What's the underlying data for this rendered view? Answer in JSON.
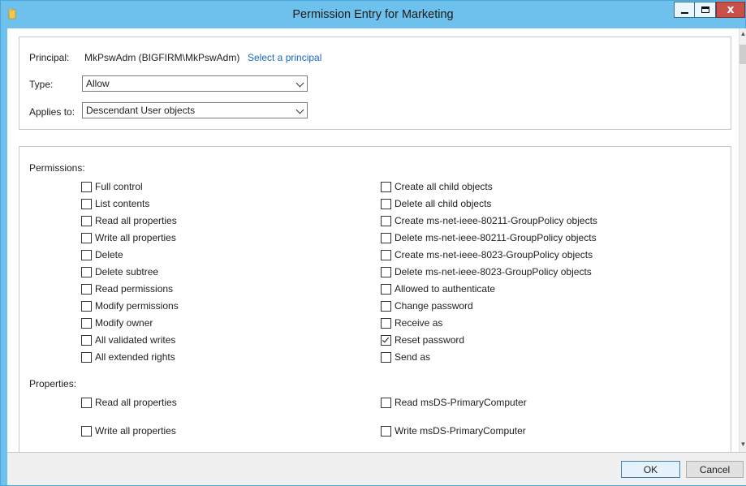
{
  "window": {
    "title": "Permission Entry for Marketing",
    "close_glyph": "x"
  },
  "header": {
    "principal_label": "Principal:",
    "principal_value": "MkPswAdm (BIGFIRM\\MkPswAdm)",
    "select_principal_link": "Select a principal",
    "type_label": "Type:",
    "type_value": "Allow",
    "applies_to_label": "Applies to:",
    "applies_to_value": "Descendant User objects"
  },
  "permissions": {
    "label": "Permissions:",
    "left": [
      {
        "label": "Full control",
        "checked": false
      },
      {
        "label": "List contents",
        "checked": false
      },
      {
        "label": "Read all properties",
        "checked": false
      },
      {
        "label": "Write all properties",
        "checked": false
      },
      {
        "label": "Delete",
        "checked": false
      },
      {
        "label": "Delete subtree",
        "checked": false
      },
      {
        "label": "Read permissions",
        "checked": false
      },
      {
        "label": "Modify permissions",
        "checked": false
      },
      {
        "label": "Modify owner",
        "checked": false
      },
      {
        "label": "All validated writes",
        "checked": false
      },
      {
        "label": "All extended rights",
        "checked": false
      }
    ],
    "right": [
      {
        "label": "Create all child objects",
        "checked": false
      },
      {
        "label": "Delete all child objects",
        "checked": false
      },
      {
        "label": "Create ms-net-ieee-80211-GroupPolicy objects",
        "checked": false
      },
      {
        "label": "Delete ms-net-ieee-80211-GroupPolicy objects",
        "checked": false
      },
      {
        "label": "Create ms-net-ieee-8023-GroupPolicy objects",
        "checked": false
      },
      {
        "label": "Delete ms-net-ieee-8023-GroupPolicy objects",
        "checked": false
      },
      {
        "label": "Allowed to authenticate",
        "checked": false
      },
      {
        "label": "Change password",
        "checked": false
      },
      {
        "label": "Receive as",
        "checked": false
      },
      {
        "label": "Reset password",
        "checked": true
      },
      {
        "label": "Send as",
        "checked": false
      }
    ]
  },
  "properties": {
    "label": "Properties:",
    "left": [
      {
        "label": "Read all properties",
        "checked": false
      },
      {
        "label": "Write all properties",
        "checked": false
      }
    ],
    "right": [
      {
        "label": "Read msDS-PrimaryComputer",
        "checked": false
      },
      {
        "label": "Write msDS-PrimaryComputer",
        "checked": false
      }
    ]
  },
  "footer": {
    "ok_label": "OK",
    "cancel_label": "Cancel"
  },
  "colors": {
    "titlebar": "#6ec1ec",
    "link": "#1665c8",
    "close_button": "#c7504b"
  }
}
